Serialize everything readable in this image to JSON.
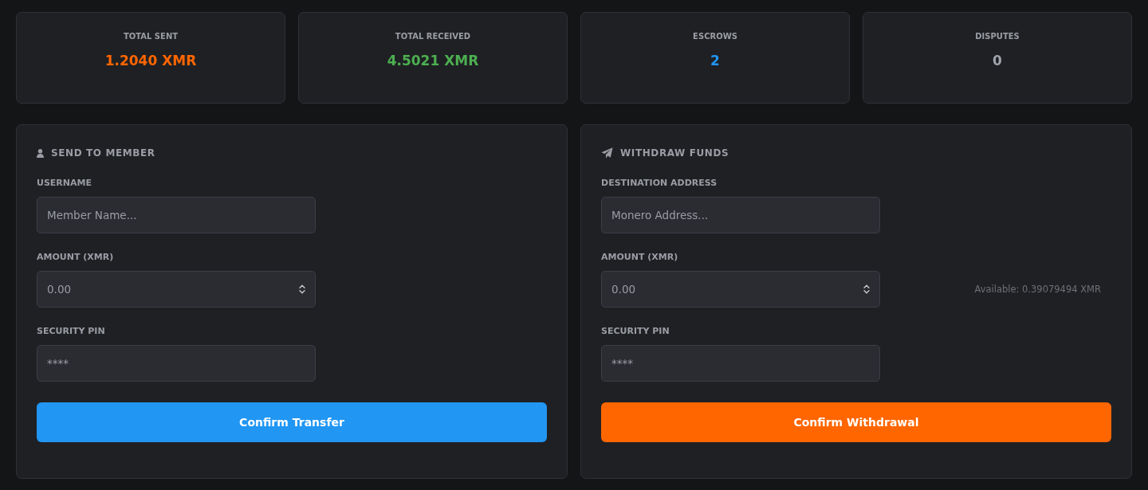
{
  "stats": [
    {
      "label": "TOTAL SENT",
      "value": "1.2040 XMR",
      "color": "#ff6600"
    },
    {
      "label": "TOTAL RECEIVED",
      "value": "4.5021 XMR",
      "color": "#4caf50"
    },
    {
      "label": "ESCROWS",
      "value": "2",
      "color": "#2196f3"
    },
    {
      "label": "DISPUTES",
      "value": "0",
      "color": "#a0a3aa"
    }
  ],
  "panels": [
    {
      "kind": "transfer",
      "title": "SEND TO MEMBER",
      "fields": [
        {
          "kind": "text",
          "label": "USERNAME",
          "placeholder": "Member Name..."
        },
        {
          "kind": "number",
          "label": "AMOUNT (XMR)",
          "placeholder": "0.00"
        },
        {
          "kind": "password",
          "label": "SECURITY PIN",
          "placeholder": "****"
        }
      ],
      "button": {
        "label": "Confirm Transfer",
        "color": "#2196f3"
      }
    },
    {
      "kind": "withdraw",
      "title": "WITHDRAW FUNDS",
      "fields": [
        {
          "kind": "text",
          "label": "DESTINATION ADDRESS",
          "placeholder": "Monero Address..."
        },
        {
          "kind": "number",
          "label": "AMOUNT (XMR)",
          "placeholder": "0.00",
          "note": "Available: 0.39079494 XMR"
        },
        {
          "kind": "password",
          "label": "SECURITY PIN",
          "placeholder": "****"
        }
      ],
      "button": {
        "label": "Confirm Withdrawal",
        "color": "#ff6600"
      }
    }
  ]
}
